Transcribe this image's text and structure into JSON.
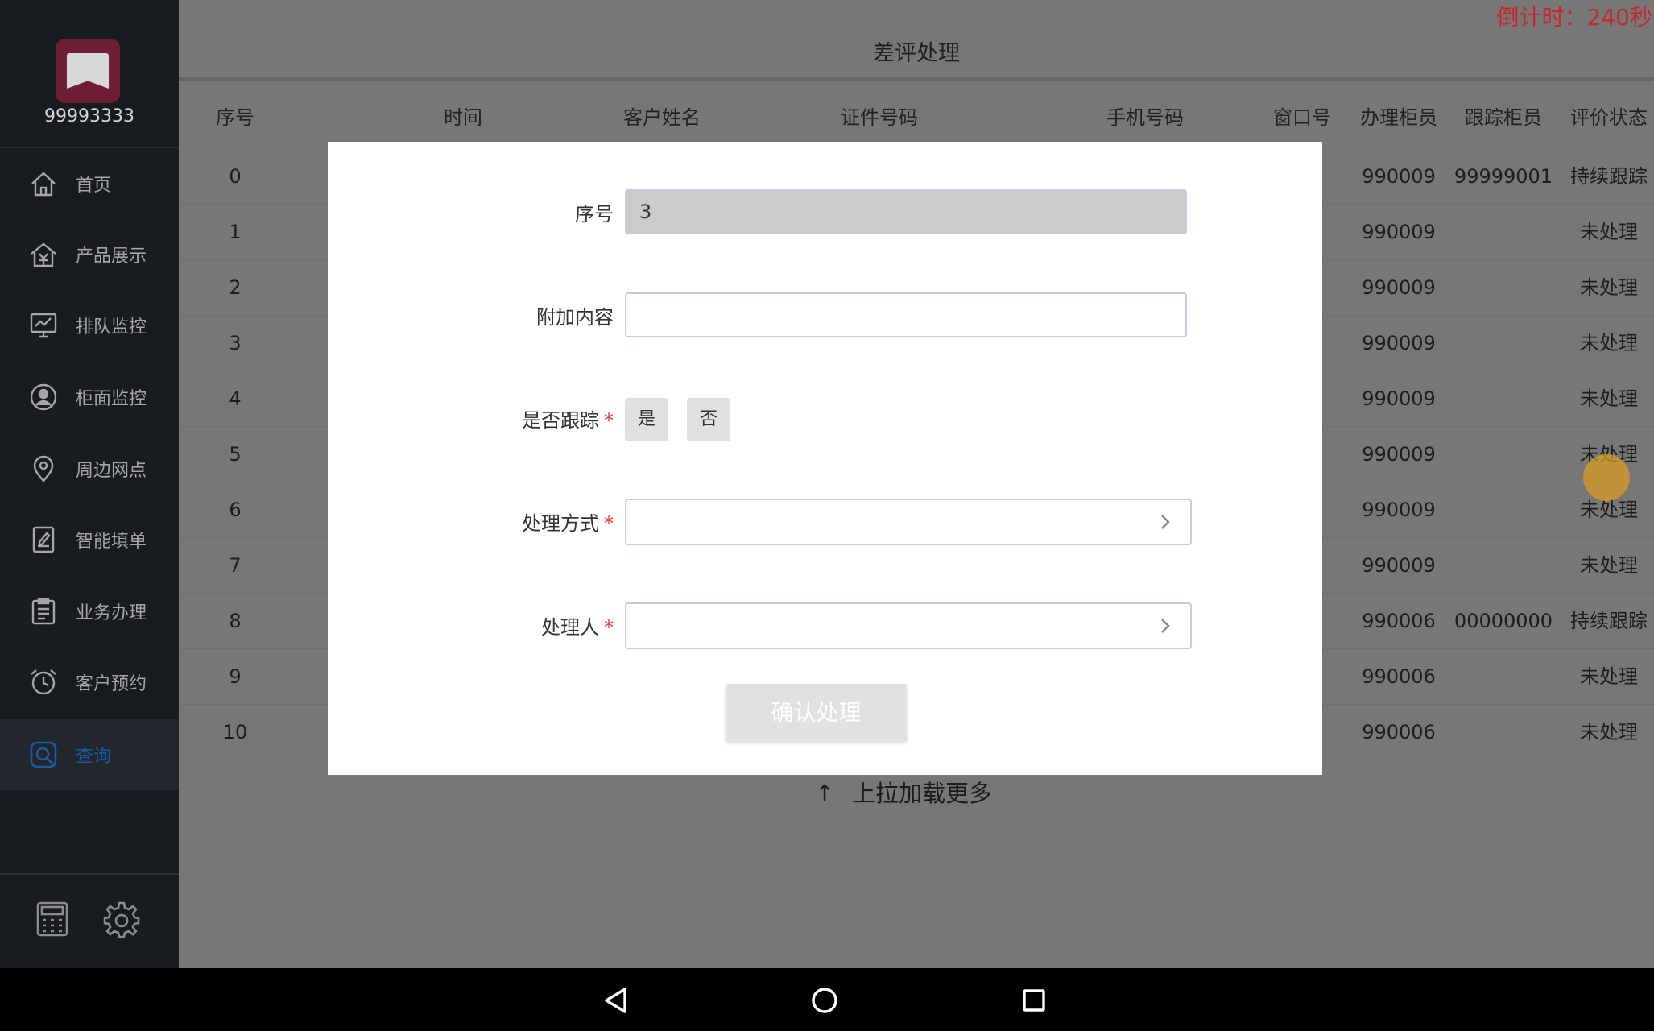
{
  "sidebar": {
    "branch_no": "99993333",
    "items": [
      {
        "label": "首页",
        "icon": "home-icon"
      },
      {
        "label": "产品展示",
        "icon": "product-icon"
      },
      {
        "label": "排队监控",
        "icon": "queue-monitor-icon"
      },
      {
        "label": "柜面监控",
        "icon": "counter-monitor-icon"
      },
      {
        "label": "周边网点",
        "icon": "location-icon"
      },
      {
        "label": "智能填单",
        "icon": "form-icon"
      },
      {
        "label": "业务办理",
        "icon": "business-icon"
      },
      {
        "label": "客户预约",
        "icon": "alarm-clock-icon"
      },
      {
        "label": "查询",
        "icon": "search-icon",
        "active": true
      }
    ],
    "bottom_icons": [
      "calculator-icon",
      "gear-icon"
    ]
  },
  "header": {
    "countdown": "倒计时：240秒",
    "title": "差评处理"
  },
  "table": {
    "columns": [
      "序号",
      "时间",
      "客户姓名",
      "证件号码",
      "手机号码",
      "窗口号",
      "办理柜员",
      "跟踪柜员",
      "评价状态"
    ],
    "rows": [
      {
        "no": "0",
        "teller": "990009",
        "tracker": "99999001",
        "status": "持续跟踪"
      },
      {
        "no": "1",
        "teller": "990009",
        "tracker": "",
        "status": "未处理"
      },
      {
        "no": "2",
        "teller": "990009",
        "tracker": "",
        "status": "未处理"
      },
      {
        "no": "3",
        "teller": "990009",
        "tracker": "",
        "status": "未处理"
      },
      {
        "no": "4",
        "teller": "990009",
        "tracker": "",
        "status": "未处理"
      },
      {
        "no": "5",
        "teller": "990009",
        "tracker": "",
        "status": "未处理"
      },
      {
        "no": "6",
        "teller": "990009",
        "tracker": "",
        "status": "未处理"
      },
      {
        "no": "7",
        "teller": "990009",
        "tracker": "",
        "status": "未处理"
      },
      {
        "no": "8",
        "teller": "990006",
        "tracker": "00000000",
        "status": "持续跟踪"
      },
      {
        "no": "9",
        "teller": "990006",
        "tracker": "",
        "status": "未处理"
      },
      {
        "no": "10",
        "teller": "990006",
        "tracker": "",
        "status": "未处理"
      }
    ],
    "load_more": "上拉加载更多",
    "load_more_arrow": "↑"
  },
  "modal": {
    "seq_label": "序号",
    "seq_value": "3",
    "extra_label": "附加内容",
    "extra_value": "",
    "track_label": "是否跟踪",
    "track_yes": "是",
    "track_no": "否",
    "method_label": "处理方式",
    "handler_label": "处理人",
    "required_mark": "*",
    "confirm_label": "确认处理"
  },
  "navbar": {
    "buttons": [
      "back-icon",
      "home-circle-icon",
      "recents-icon"
    ]
  }
}
